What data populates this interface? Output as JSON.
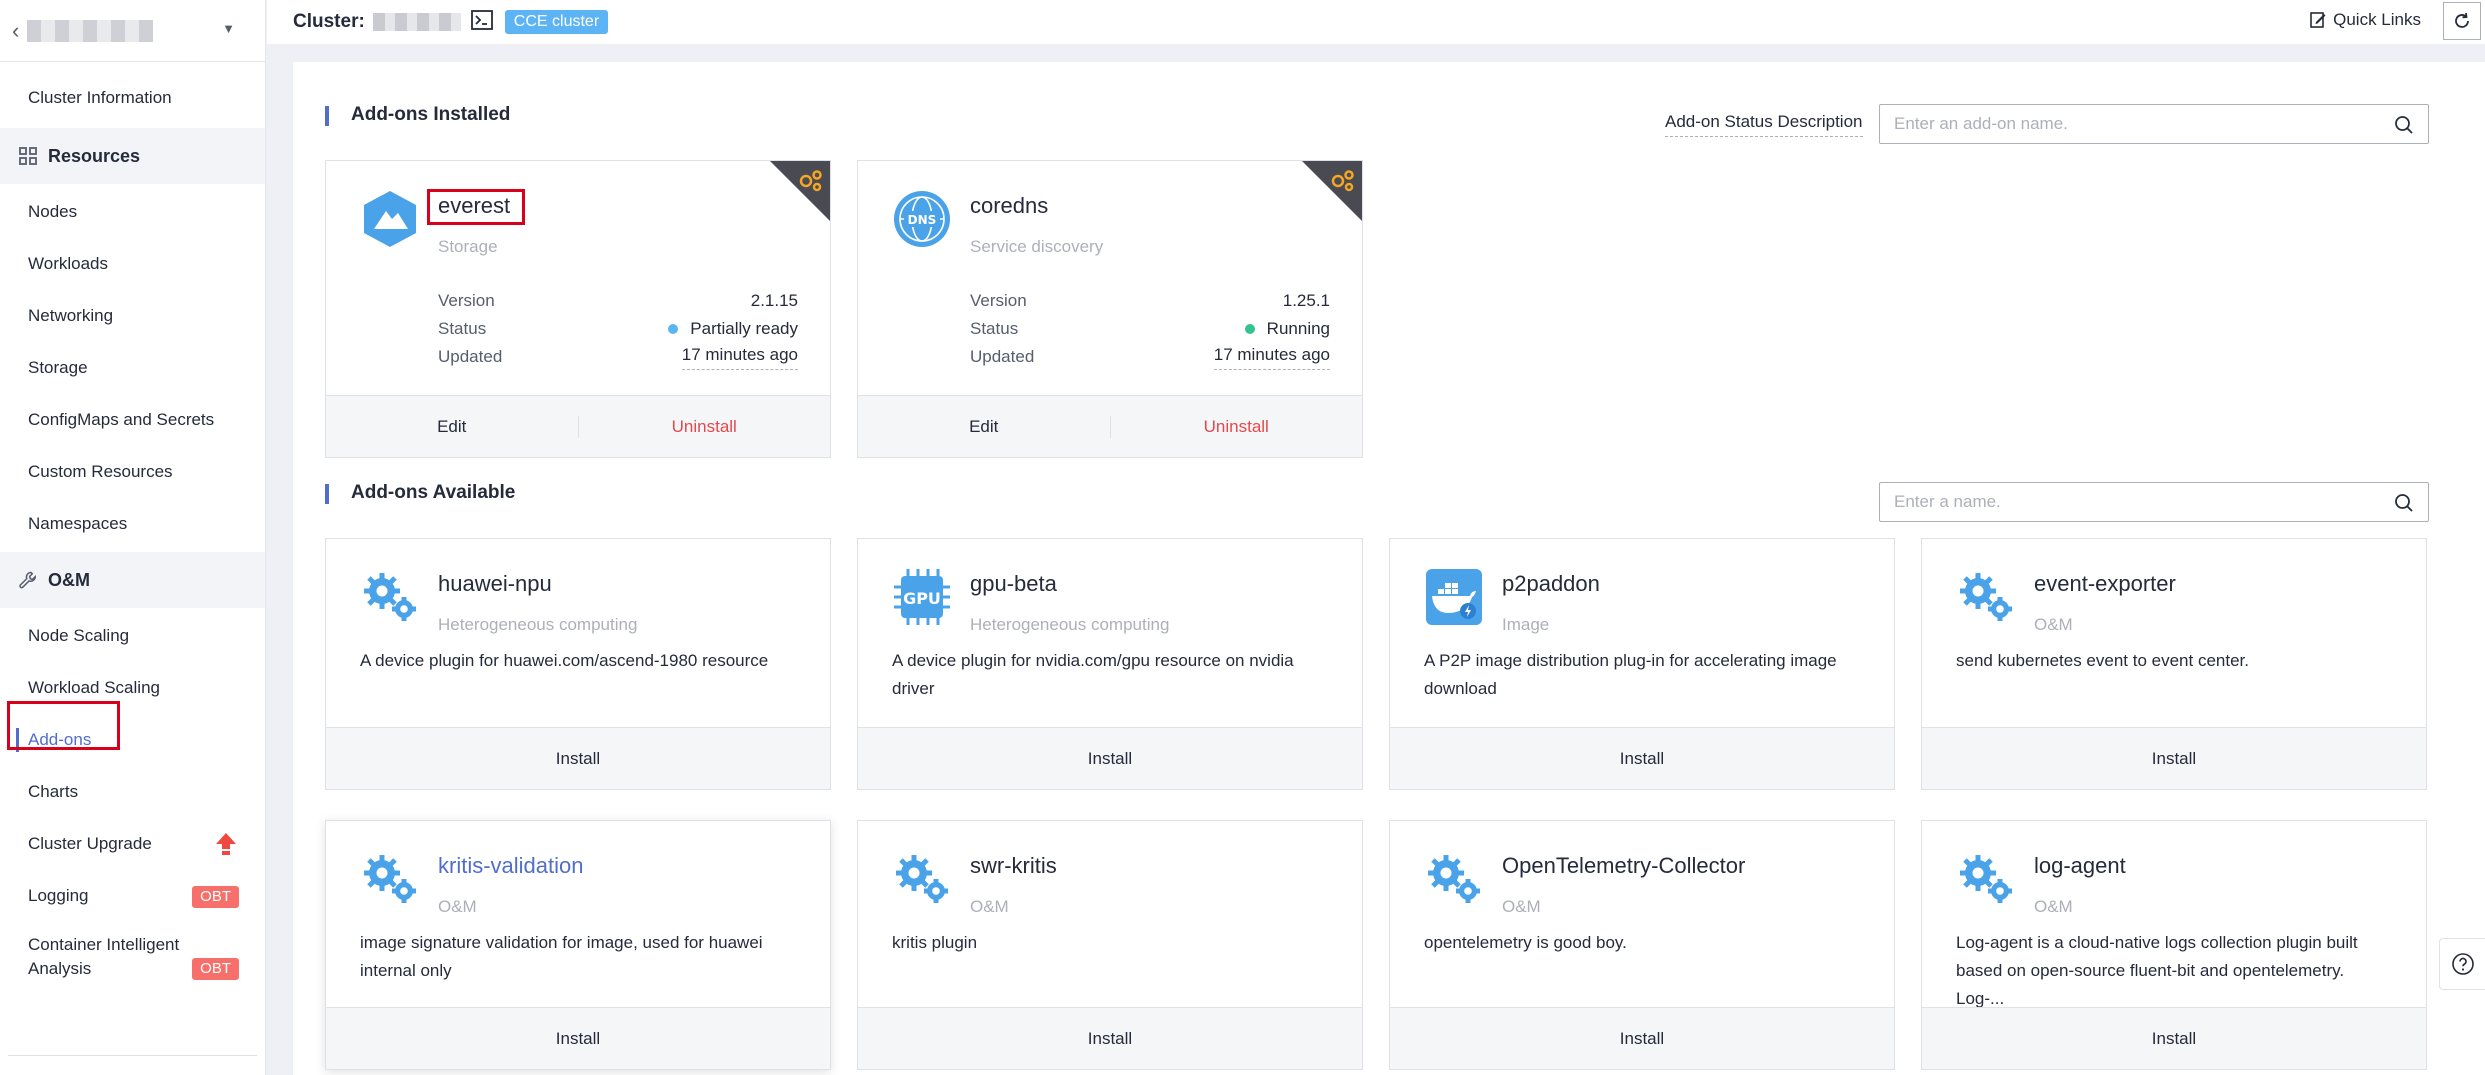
{
  "sidebar": {
    "groups": {
      "resources": "Resources",
      "om": "O&M"
    },
    "items": {
      "cluster_information": "Cluster Information",
      "nodes": "Nodes",
      "workloads": "Workloads",
      "networking": "Networking",
      "storage": "Storage",
      "configmaps": "ConfigMaps and Secrets",
      "custom_resources": "Custom Resources",
      "namespaces": "Namespaces",
      "node_scaling": "Node Scaling",
      "workload_scaling": "Workload Scaling",
      "addons": "Add-ons",
      "charts": "Charts",
      "cluster_upgrade": "Cluster Upgrade",
      "logging": "Logging",
      "container_analysis": "Container Intelligent Analysis"
    },
    "badges": {
      "logging": "OBT",
      "container_analysis": "OBT"
    }
  },
  "topbar": {
    "cluster_label": "Cluster:",
    "cluster_tag": "CCE cluster",
    "quick_links": "Quick Links"
  },
  "installed": {
    "title": "Add-ons Installed",
    "status_desc": "Add-on Status Description",
    "search_placeholder": "Enter an add-on name.",
    "cards": [
      {
        "name": "everest",
        "category": "Storage",
        "version_label": "Version",
        "version": "2.1.15",
        "status_label": "Status",
        "status": "Partially ready",
        "status_color": "#5cb4f4",
        "updated_label": "Updated",
        "updated": "17 minutes ago",
        "edit": "Edit",
        "uninstall": "Uninstall"
      },
      {
        "name": "coredns",
        "category": "Service discovery",
        "version_label": "Version",
        "version": "1.25.1",
        "status_label": "Status",
        "status": "Running",
        "status_color": "#34c38f",
        "updated_label": "Updated",
        "updated": "17 minutes ago",
        "edit": "Edit",
        "uninstall": "Uninstall"
      }
    ]
  },
  "available": {
    "title": "Add-ons Available",
    "search_placeholder": "Enter a name.",
    "install_label": "Install",
    "cards": [
      {
        "name": "huawei-npu",
        "category": "Heterogeneous computing",
        "desc": "A device plugin for huawei.com/ascend-1980 resource",
        "icon": "gears-icon"
      },
      {
        "name": "gpu-beta",
        "category": "Heterogeneous computing",
        "desc": "A device plugin for nvidia.com/gpu resource on nvidia driver",
        "icon": "gpu-icon"
      },
      {
        "name": "p2paddon",
        "category": "Image",
        "desc": "A P2P image distribution plug-in for accelerating image download",
        "icon": "docker-icon"
      },
      {
        "name": "event-exporter",
        "category": "O&M",
        "desc": "send kubernetes event to event center.",
        "icon": "gears-icon"
      },
      {
        "name": "kritis-validation",
        "category": "O&M",
        "desc": "image signature validation for image, used for huawei internal only",
        "icon": "gears-icon"
      },
      {
        "name": "swr-kritis",
        "category": "O&M",
        "desc": "kritis plugin",
        "icon": "gears-icon"
      },
      {
        "name": "OpenTelemetry-Collector",
        "category": "O&M",
        "desc": "opentelemetry is good boy.",
        "icon": "gears-icon"
      },
      {
        "name": "log-agent",
        "category": "O&M",
        "desc": "Log-agent is a cloud-native logs collection plugin built based on open-source fluent-bit and opentelemetry. Log-...",
        "icon": "gears-icon"
      }
    ]
  },
  "colors": {
    "accent": "#526ecc",
    "danger": "#e5484d",
    "highlight_box": "#d9001b"
  }
}
